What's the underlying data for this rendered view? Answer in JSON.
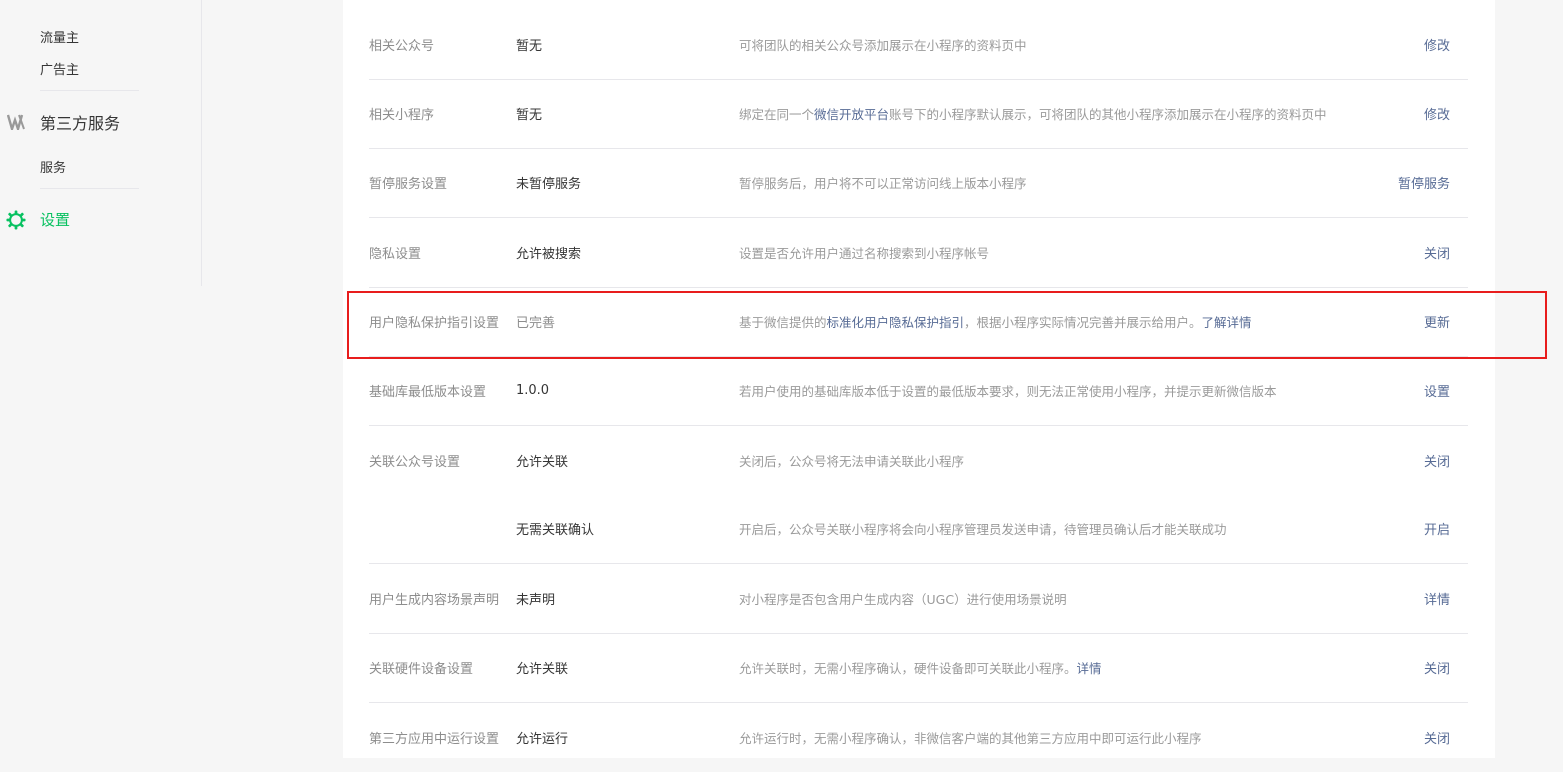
{
  "sidebar": {
    "sub_items_top": [
      "流量主",
      "广告主"
    ],
    "third_party": {
      "label": "第三方服务",
      "icon": "third-party-icon"
    },
    "third_party_items": [
      "服务"
    ],
    "settings": {
      "label": "设置",
      "icon": "gear-icon",
      "active": true
    }
  },
  "settings_rows": [
    {
      "label": "相关公众号",
      "value": "暂无",
      "desc": [
        "可将团队的相关公众号添加展示在小程序的资料页中"
      ],
      "action": "修改"
    },
    {
      "label": "相关小程序",
      "value": "暂无",
      "desc": [
        "绑定在同一个",
        "微信开放平台",
        "账号下的小程序默认展示，可将团队的其他小程序添加展示在小程序的资料页中"
      ],
      "action": "修改"
    },
    {
      "label": "暂停服务设置",
      "value": "未暂停服务",
      "desc": [
        "暂停服务后，用户将不可以正常访问线上版本小程序"
      ],
      "action": "暂停服务"
    },
    {
      "label": "隐私设置",
      "value": "允许被搜索",
      "desc": [
        "设置是否允许用户通过名称搜索到小程序帐号"
      ],
      "action": "关闭"
    },
    {
      "label": "用户隐私保护指引设置",
      "value": "已完善",
      "desc": [
        "基于微信提供的",
        "标准化用户隐私保护指引",
        "，根据小程序实际情况完善并展示给用户。",
        "了解详情"
      ],
      "action": "更新"
    },
    {
      "label": "基础库最低版本设置",
      "value": "1.0.0",
      "desc": [
        "若用户使用的基础库版本低于设置的最低版本要求，则无法正常使用小程序，并提示更新微信版本"
      ],
      "action": "设置"
    },
    {
      "label": "关联公众号设置",
      "value": "允许关联",
      "desc": [
        "关闭后，公众号将无法申请关联此小程序"
      ],
      "action": "关闭"
    },
    {
      "label": "",
      "value": "无需关联确认",
      "desc": [
        "开启后，公众号关联小程序将会向小程序管理员发送申请，待管理员确认后才能关联成功"
      ],
      "action": "开启"
    },
    {
      "label": "用户生成内容场景声明",
      "value": "未声明",
      "desc": [
        "对小程序是否包含用户生成内容（UGC）进行使用场景说明"
      ],
      "action": "详情"
    },
    {
      "label": "关联硬件设备设置",
      "value": "允许关联",
      "desc": [
        "允许关联时，无需小程序确认，硬件设备即可关联此小程序。",
        " 详情"
      ],
      "action": "关闭"
    },
    {
      "label": "第三方应用中运行设置",
      "value": "允许运行",
      "desc": [
        "允许运行时，无需小程序确认，非微信客户端的其他第三方应用中即可运行此小程序"
      ],
      "action": "关闭"
    }
  ],
  "colors": {
    "accent_green": "#07c160",
    "link_blue": "#576b95",
    "highlight_red": "#e81d1d"
  }
}
